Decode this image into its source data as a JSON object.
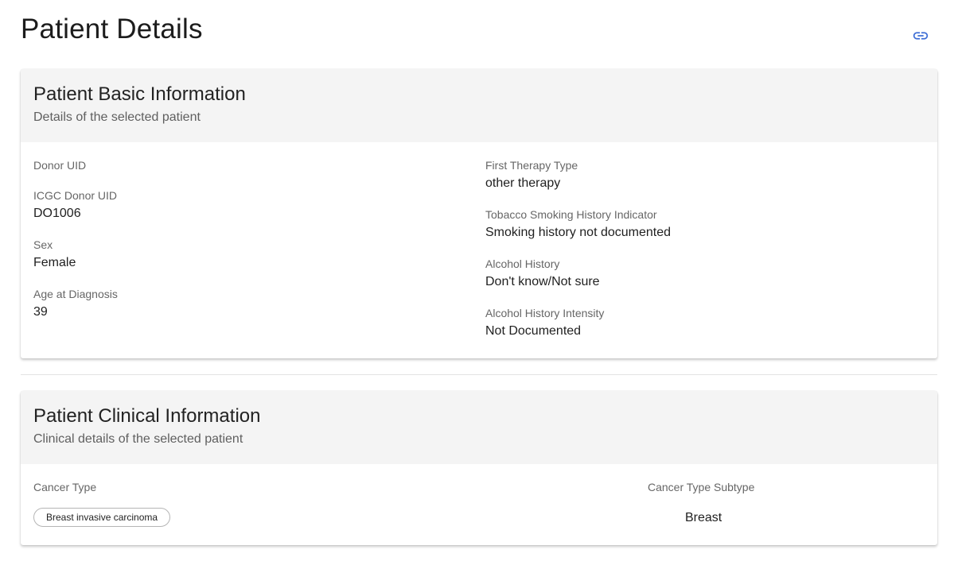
{
  "page": {
    "title": "Patient Details"
  },
  "icons": {
    "share_link": "link-icon"
  },
  "colors": {
    "accent": "#3f6fd6",
    "card_header_bg": "#f4f4f4"
  },
  "basic_info": {
    "title": "Patient Basic Information",
    "subtitle": "Details of the selected patient",
    "fields": {
      "donor_uid": {
        "label": "Donor UID",
        "value": ""
      },
      "icgc_donor_uid": {
        "label": "ICGC Donor UID",
        "value": "DO1006"
      },
      "sex": {
        "label": "Sex",
        "value": "Female"
      },
      "age_at_diagnosis": {
        "label": "Age at Diagnosis",
        "value": "39"
      },
      "first_therapy_type": {
        "label": "First Therapy Type",
        "value": "other therapy"
      },
      "tobacco_history": {
        "label": "Tobacco Smoking History Indicator",
        "value": "Smoking history not documented"
      },
      "alcohol_history": {
        "label": "Alcohol History",
        "value": "Don't know/Not sure"
      },
      "alcohol_intensity": {
        "label": "Alcohol History Intensity",
        "value": "Not Documented"
      }
    }
  },
  "clinical_info": {
    "title": "Patient Clinical Information",
    "subtitle": "Clinical details of the selected patient",
    "cancer_type": {
      "label": "Cancer Type",
      "chip": "Breast invasive carcinoma"
    },
    "cancer_subtype": {
      "label": "Cancer Type Subtype",
      "value": "Breast"
    }
  }
}
